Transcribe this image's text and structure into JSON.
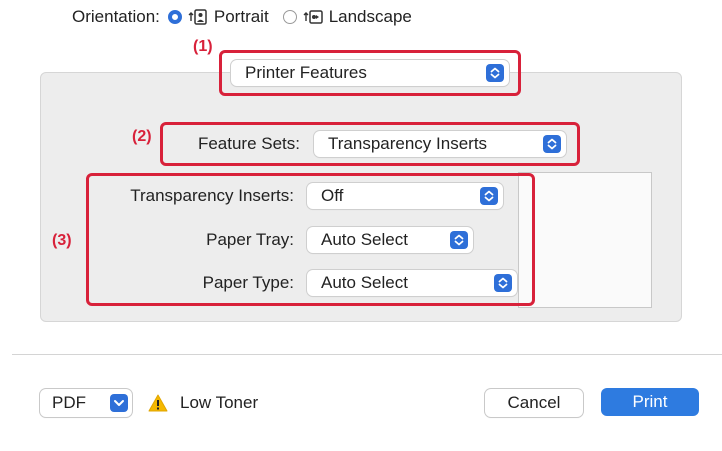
{
  "orientation": {
    "label": "Orientation:",
    "portrait_label": "Portrait",
    "landscape_label": "Landscape",
    "selected": "Portrait"
  },
  "callouts": {
    "one": "(1)",
    "two": "(2)",
    "three": "(3)"
  },
  "panel_select": {
    "value": "Printer Features"
  },
  "feature_sets": {
    "label": "Feature Sets:",
    "value": "Transparency Inserts"
  },
  "options": [
    {
      "label": "Transparency Inserts:",
      "value": "Off"
    },
    {
      "label": "Paper Tray:",
      "value": "Auto Select"
    },
    {
      "label": "Paper Type:",
      "value": "Auto Select"
    }
  ],
  "footer": {
    "pdf_label": "PDF",
    "warning_text": "Low Toner",
    "cancel_label": "Cancel",
    "print_label": "Print"
  },
  "colors": {
    "accent": "#2e6fd8",
    "highlight": "#d8213a",
    "warning": "#f5b800"
  },
  "icons": [
    "portrait-orientation-icon",
    "landscape-orientation-icon",
    "chevron-updown-icon",
    "chevron-down-icon",
    "warning-icon"
  ]
}
